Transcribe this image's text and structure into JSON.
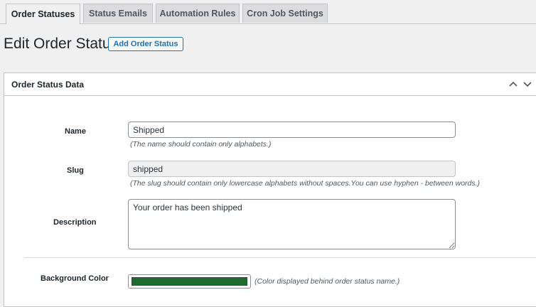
{
  "tabs": [
    {
      "label": "Order Statuses",
      "active": true
    },
    {
      "label": "Status Emails",
      "active": false
    },
    {
      "label": "Automation Rules",
      "active": false
    },
    {
      "label": "Cron Job Settings",
      "active": false
    }
  ],
  "page": {
    "title": "Edit Order Status",
    "add_button_label": "Add Order Status"
  },
  "panel": {
    "title": "Order Status Data",
    "icons": [
      "chevron-up-icon",
      "chevron-down-icon"
    ]
  },
  "form": {
    "name": {
      "label": "Name",
      "value": "Shipped",
      "hint": "(The name should contain only alphabets.)"
    },
    "slug": {
      "label": "Slug",
      "value": "shipped",
      "hint": "(The slug should contain only lowercase alphabets without spaces.You can use hyphen - between words.)"
    },
    "description": {
      "label": "Description",
      "value": "Your order has been shipped"
    },
    "background_color": {
      "label": "Background Color",
      "value": "#1e6b2e",
      "hint": "(Color displayed behind order status name.)"
    }
  },
  "colors": {
    "accent": "#2271b1",
    "background": "#f0f0f1",
    "panel": "#ffffff",
    "border": "#c3c4c7"
  }
}
